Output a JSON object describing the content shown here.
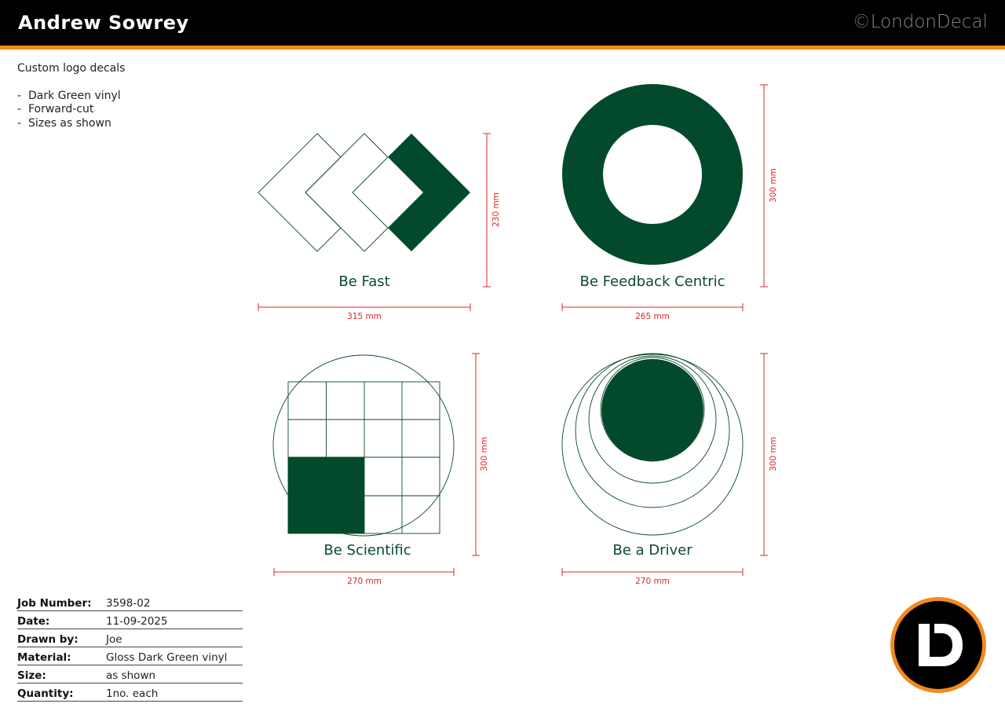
{
  "header": {
    "client_name": "Andrew Sowrey",
    "brand": "©LondonDecal"
  },
  "notes": {
    "title": "Custom logo decals",
    "items": [
      "Dark Green vinyl",
      "Forward-cut",
      "Sizes as shown"
    ]
  },
  "decals": [
    {
      "label": "Be Fast",
      "width": "315 mm",
      "height": "230 mm"
    },
    {
      "label": "Be Feedback Centric",
      "width": "265 mm",
      "height": "300 mm"
    },
    {
      "label": "Be Scientific",
      "width": "270 mm",
      "height": "300 mm"
    },
    {
      "label": "Be a Driver",
      "width": "270 mm",
      "height": "300 mm"
    }
  ],
  "info": {
    "rows": [
      {
        "key": "Job Number:",
        "value": "3598-02"
      },
      {
        "key": "Date:",
        "value": "11-09-2025"
      },
      {
        "key": "Drawn by:",
        "value": "Joe"
      },
      {
        "key": "Material:",
        "value": "Gloss Dark Green vinyl"
      },
      {
        "key": "Size:",
        "value": "as shown"
      },
      {
        "key": "Quantity:",
        "value": "1no. each"
      }
    ]
  },
  "colors": {
    "vinyl_green": "#034a2d",
    "dimension_red": "#e0242a",
    "accent_orange": "#f28a1d"
  },
  "logo": {
    "icon": "london-decal-ld-logo"
  }
}
